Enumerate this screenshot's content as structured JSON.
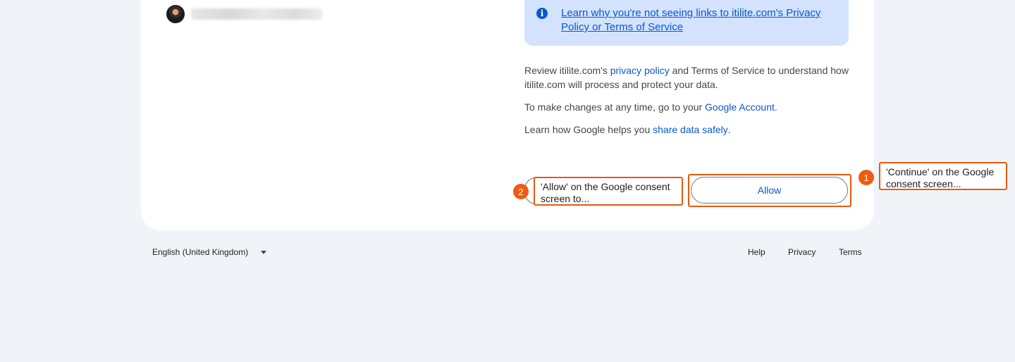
{
  "account": {
    "avatar_icon": "user-avatar"
  },
  "info_box": {
    "icon": "info-icon",
    "icon_glyph": "i",
    "link_text": "Learn why you're not seeing links to itilite.com's Privacy Policy or Terms of Service"
  },
  "review": {
    "prefix": "Review itilite.com's ",
    "privacy_link": "privacy policy",
    "suffix": " and Terms of Service to understand how itilite.com will process and protect your data."
  },
  "changes": {
    "prefix": "To make changes at any time, go to your ",
    "account_link": "Google Account",
    "suffix": "."
  },
  "share": {
    "prefix": "Learn how Google helps you ",
    "share_link": "share data safely",
    "suffix": "."
  },
  "allow_button": {
    "label": "Allow"
  },
  "annotations": [
    {
      "number": "1",
      "text": "'Continue' on the Google consent screen..."
    },
    {
      "number": "2",
      "text": "'Allow' on the Google consent screen to..."
    }
  ],
  "footer": {
    "language": "English (United Kingdom)",
    "links": [
      "Help",
      "Privacy",
      "Terms"
    ]
  },
  "colors": {
    "accent": "#0b57d0",
    "highlight": "#e8580c",
    "badge": "#f25a0f",
    "background": "#f0f4f9",
    "info_bg": "#d3e3fd"
  }
}
